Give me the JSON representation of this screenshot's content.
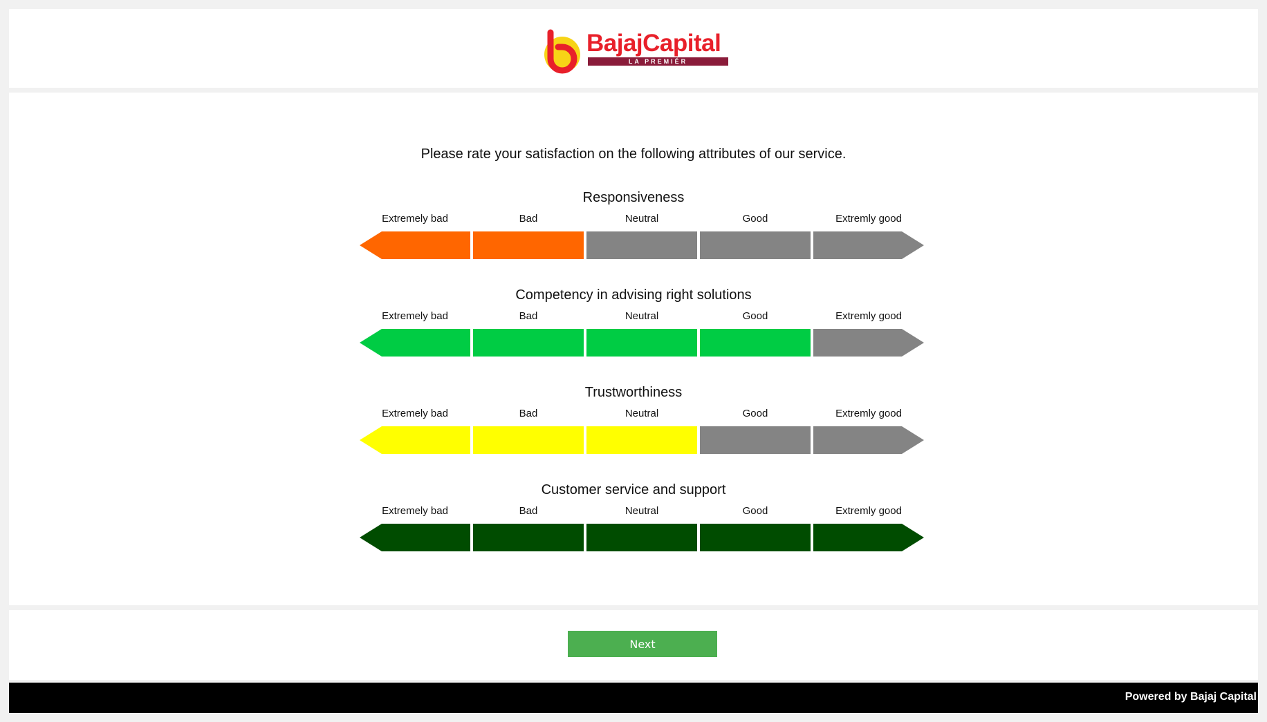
{
  "logo": {
    "word_part1": "Bajaj",
    "word_part2": "Capital",
    "tagline": "LA PREMIÉR",
    "colors": {
      "red": "#e8202a",
      "yellow": "#f7d417",
      "maroon": "#8a1c3a"
    }
  },
  "survey": {
    "intro": "Please rate your satisfaction on the following attributes of our service.",
    "scale_labels": [
      "Extremely bad",
      "Bad",
      "Neutral",
      "Good",
      "Extremly good"
    ],
    "inactive_color": "#848484",
    "questions": [
      {
        "title": "Responsiveness",
        "rating": 2,
        "color": "#ff6600"
      },
      {
        "title": "Competency in advising right solutions",
        "rating": 4,
        "color": "#00cc44"
      },
      {
        "title": "Trustworthiness",
        "rating": 3,
        "color": "#ffff00"
      },
      {
        "title": "Customer service and support",
        "rating": 5,
        "color": "#004c00"
      }
    ]
  },
  "actions": {
    "next_label": "Next",
    "next_color": "#4caf50"
  },
  "footer": {
    "powered_by": "Powered by Bajaj Capital"
  }
}
